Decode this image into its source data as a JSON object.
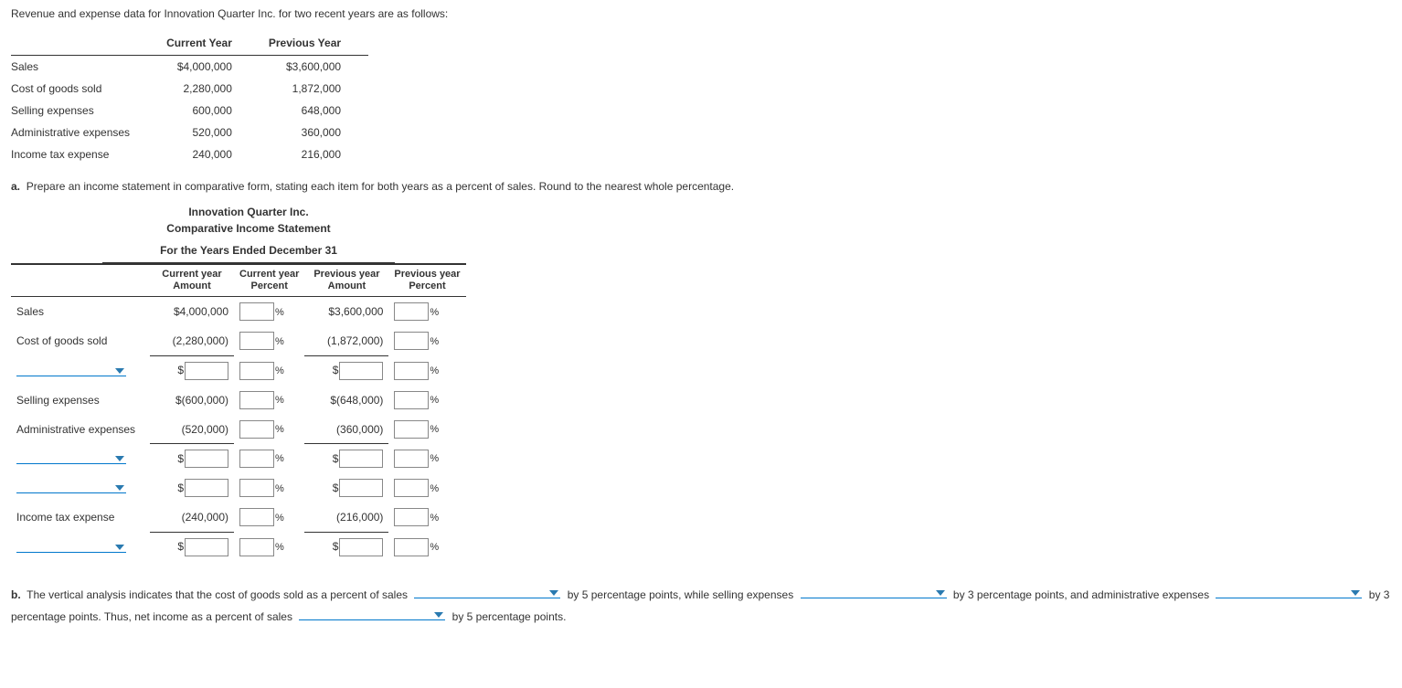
{
  "intro": "Revenue and expense data for Innovation Quarter Inc. for two recent years are as follows:",
  "data_table": {
    "headers": [
      "",
      "Current Year",
      "Previous Year"
    ],
    "rows": [
      {
        "label": "Sales",
        "cy": "$4,000,000",
        "py": "$3,600,000"
      },
      {
        "label": "Cost of goods sold",
        "cy": "2,280,000",
        "py": "1,872,000"
      },
      {
        "label": "Selling expenses",
        "cy": "600,000",
        "py": "648,000"
      },
      {
        "label": "Administrative expenses",
        "cy": "520,000",
        "py": "360,000"
      },
      {
        "label": "Income tax expense",
        "cy": "240,000",
        "py": "216,000"
      }
    ]
  },
  "part_a": {
    "label": "a.",
    "text": "Prepare an income statement in comparative form, stating each item for both years as a percent of sales. Round to the nearest whole percentage."
  },
  "statement": {
    "company": "Innovation Quarter Inc.",
    "title": "Comparative Income Statement",
    "period": "For the Years Ended December 31",
    "col_headers": [
      "Current year Amount",
      "Current year Percent",
      "Previous year Amount",
      "Previous year Percent"
    ],
    "rows": [
      {
        "type": "fixed",
        "label": "Sales",
        "cy_amt": "$4,000,000",
        "py_amt": "$3,600,000"
      },
      {
        "type": "fixed_underline",
        "label": "Cost of goods sold",
        "cy_amt": "(2,280,000)",
        "py_amt": "(1,872,000)"
      },
      {
        "type": "dropdown_input"
      },
      {
        "type": "fixed",
        "label": "Selling expenses",
        "cy_amt": "$(600,000)",
        "py_amt": "$(648,000)"
      },
      {
        "type": "fixed_underline",
        "label": "Administrative expenses",
        "cy_amt": "(520,000)",
        "py_amt": "(360,000)"
      },
      {
        "type": "dropdown_input"
      },
      {
        "type": "dropdown_input"
      },
      {
        "type": "fixed_underline",
        "label": "Income tax expense",
        "cy_amt": "(240,000)",
        "py_amt": "(216,000)"
      },
      {
        "type": "dropdown_input"
      }
    ]
  },
  "part_b": {
    "label": "b.",
    "seg1": "The vertical analysis indicates that the cost of goods sold as a percent of sales",
    "seg2": "by 5 percentage points, while selling expenses",
    "seg3": "by 3 percentage points, and administrative expenses",
    "seg4": "by 3 percentage points. Thus, net income as a percent of sales",
    "seg5": "by 5 percentage points."
  }
}
